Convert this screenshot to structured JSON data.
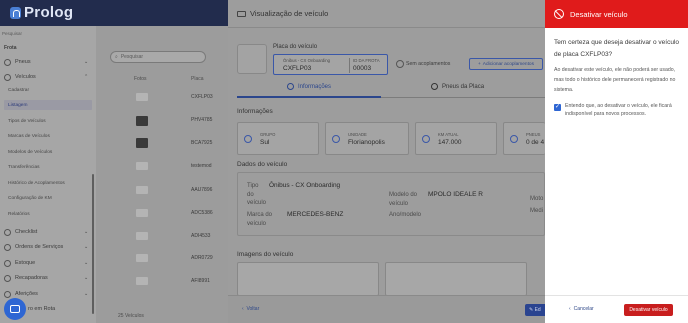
{
  "app": {
    "brand": "Prolog"
  },
  "sidebar": {
    "search_label": "Pesquisar",
    "section": "Frota",
    "items": [
      {
        "label": "Pneus",
        "icon": "tire-icon"
      },
      {
        "label": "Veículos",
        "icon": "truck-icon"
      }
    ],
    "sub_items": [
      "Cadastrar",
      "Listagem",
      "Tipos de Veículos",
      "Marcas de Veículos",
      "Modelos de Veículos",
      "Transferências",
      "Histórico de Acoplamentos",
      "Configuração de KM",
      "Relatórios"
    ],
    "bottom_items": [
      {
        "label": "Checklist",
        "icon": "checklist-icon"
      },
      {
        "label": "Ordens de Serviços",
        "icon": "wrench-icon"
      },
      {
        "label": "Estoque",
        "icon": "box-icon"
      },
      {
        "label": "Recapadoras",
        "icon": "recap-icon"
      },
      {
        "label": "Aferições",
        "icon": "gauge-icon"
      },
      {
        "label": "ro em Rota",
        "icon": "route-icon"
      }
    ]
  },
  "list": {
    "search_placeholder": "Pesquisar",
    "col_photos": "Fotos",
    "col_plate": "Placa",
    "rows": [
      "CXFLP03",
      "PHV4785",
      "BCA7925",
      "testemod",
      "AAU7896",
      "ADC5386",
      "ADI4533",
      "ADR0729",
      "AFI8991"
    ],
    "count": "25 Veículos"
  },
  "vehicle_modal": {
    "title": "Visualização de veículo",
    "plate_section": "Placa do veículo",
    "plate_type_label": "Ônibus - CX Onboarding",
    "plate_value": "CXFLP03",
    "frota_label": "ID DA FROTA",
    "frota_value": "00003",
    "towing_label": "Sem acoplamentos",
    "add_towing": "Adicionar acoplamentos",
    "tab_info": "Informações",
    "tab_tires": "Pneus da Placa",
    "info_title": "Informações",
    "stats": [
      {
        "label": "GRUPO",
        "value": "Sul"
      },
      {
        "label": "UNIDADE",
        "value": "Florianopolis"
      },
      {
        "label": "KM ATUAL",
        "value": "147.000"
      },
      {
        "label": "PNEUS",
        "value": "0 de 4"
      }
    ],
    "dados_title": "Dados do veículo",
    "tipo_label": "Tipo do veículo",
    "tipo_value": "Ônibus - CX Onboarding",
    "marca_label": "Marca do veículo",
    "marca_value": "MERCEDES-BENZ",
    "modelo_label": "Modelo do veículo",
    "modelo_value": "MPOLO IDEALE R",
    "ano_label": "Ano/modelo",
    "motor_label": "Moto",
    "medida_label": "Medi",
    "images_title": "Imagens do veículo",
    "back": "Voltar",
    "edit": "Ed"
  },
  "drawer": {
    "title": "Desativar veículo",
    "question": "Tem certeza que deseja desativar o veículo de placa CXFLP03?",
    "warning": "Ao desativar este veículo, ele não poderá ser usado, mas todo o histórico dele permanecerá registrado no sistema.",
    "checkbox_label": "Entendo que, ao desativar o veículo, ele ficará indisponível para novos processos.",
    "checkbox_checked": true,
    "cancel": "Cancelar",
    "confirm": "Desativar veículo",
    "accent": "#e01b1b"
  }
}
